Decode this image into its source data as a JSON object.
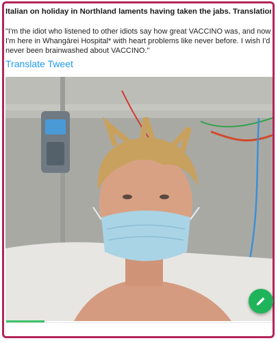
{
  "tweet": {
    "headline": "Italian on holiday in Northland laments having taken the jabs. Translation:",
    "body": "\"I'm the idiot who listened to other idiots say how great VACCINO was, and now I'm here in Whangārei Hospital* with heart problems like never before. I wish I'd never been brainwashed about VACCINO.\"",
    "translate_label": "Translate Tweet"
  },
  "photo": {
    "subject": "hospital-selfie"
  },
  "fab": {
    "icon": "pencil-icon"
  },
  "colors": {
    "frame": "#b3245a",
    "link": "#1d9bf0",
    "fab": "#1fb35a"
  }
}
